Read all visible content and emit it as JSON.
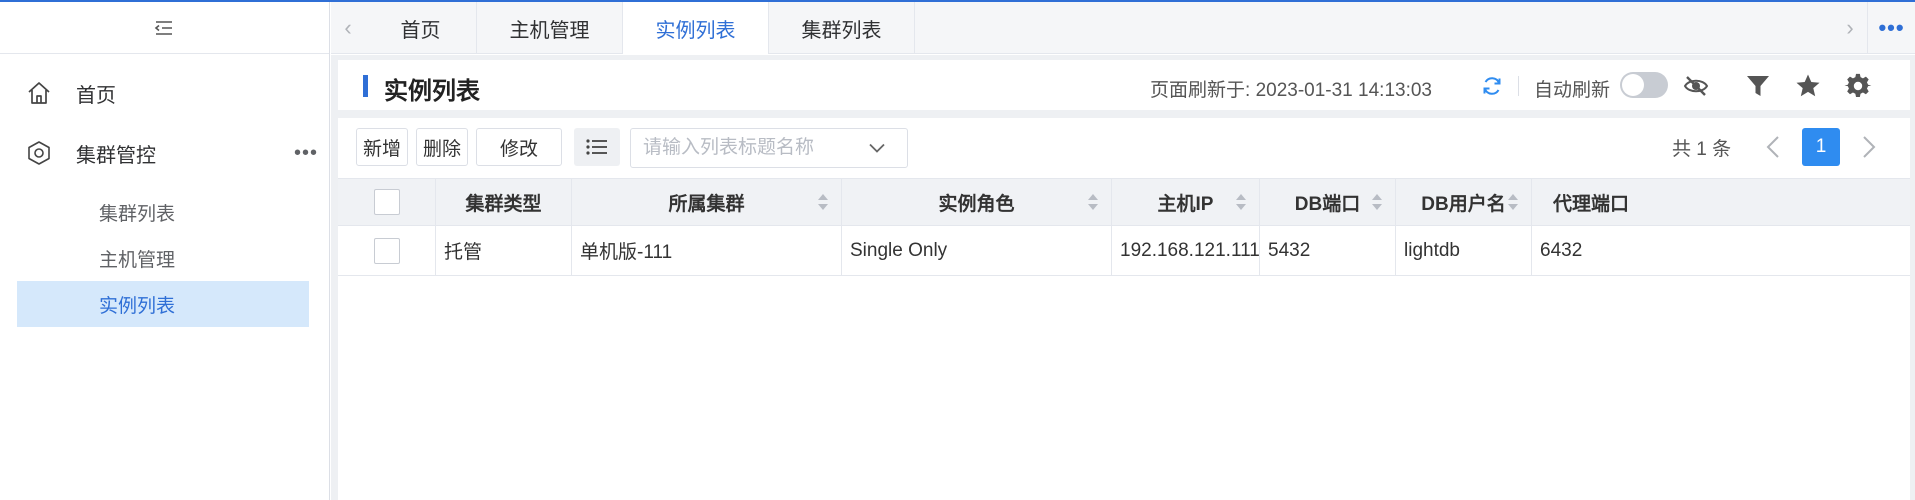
{
  "sidebar": {
    "items": [
      {
        "label": "首页",
        "icon": "home-icon"
      },
      {
        "label": "集群管控",
        "icon": "hexagon-icon",
        "more": "•••",
        "children": [
          {
            "label": "集群列表"
          },
          {
            "label": "主机管理"
          },
          {
            "label": "实例列表",
            "active": true
          }
        ]
      }
    ]
  },
  "tabs": [
    {
      "label": "首页"
    },
    {
      "label": "主机管理"
    },
    {
      "label": "实例列表",
      "active": true
    },
    {
      "label": "集群列表"
    }
  ],
  "tabs_more": "•••",
  "header": {
    "title": "实例列表",
    "refresh_label": "页面刷新于:",
    "refresh_time": "2023-01-31 14:13:03",
    "auto_refresh_label": "自动刷新",
    "auto_refresh_on": false
  },
  "toolbar": {
    "add_label": "新增",
    "delete_label": "删除",
    "edit_label": "修改",
    "search_placeholder": "请输入列表标题名称",
    "total_text": "共 1 条",
    "current_page": "1"
  },
  "table": {
    "columns": [
      "集群类型",
      "所属集群",
      "实例角色",
      "主机IP",
      "DB端口",
      "DB用户名",
      "代理端口"
    ],
    "rows": [
      [
        "托管",
        "单机版-111",
        "Single Only",
        "192.168.121.111",
        "5432",
        "lightdb",
        "6432"
      ]
    ]
  },
  "colors": {
    "accent": "#2f6fd6",
    "active_bg": "#d5e8fb",
    "page_button": "#2f8cf0"
  }
}
